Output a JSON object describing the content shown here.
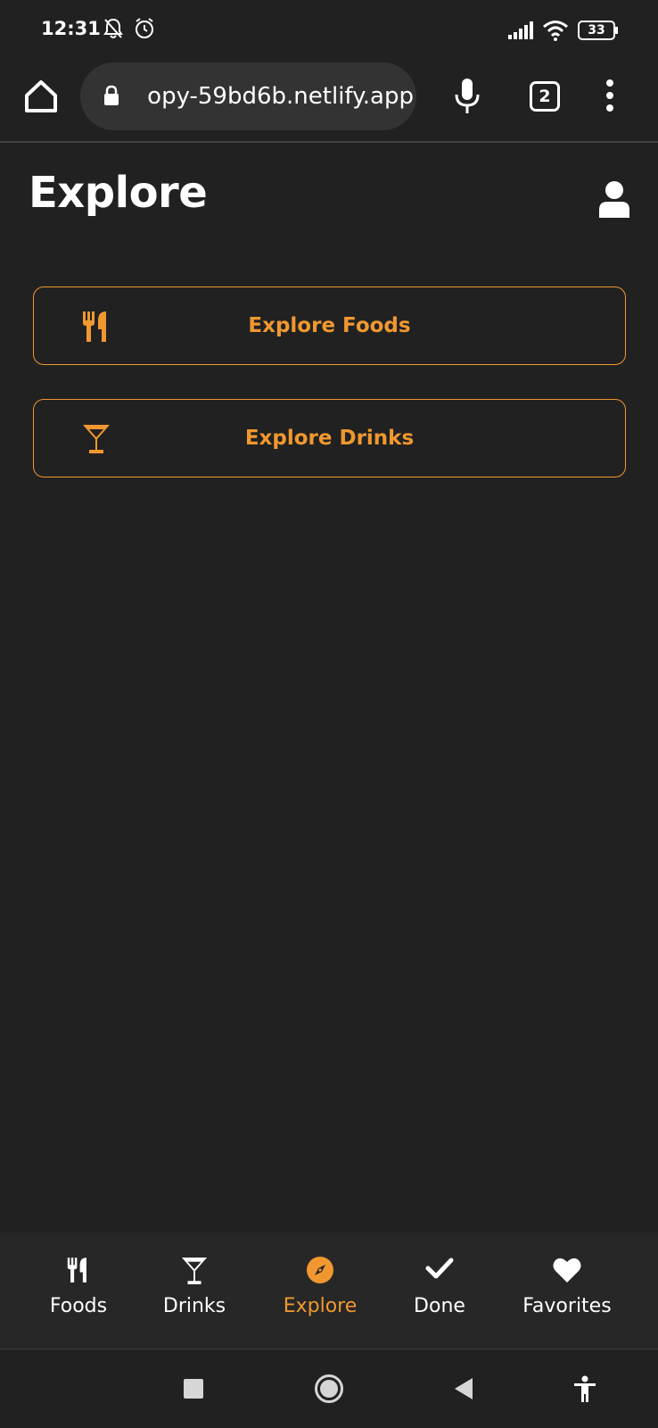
{
  "status_bar": {
    "time": "12:31",
    "icons": [
      "bell-off-icon",
      "alarm-icon",
      "signal-icon",
      "wifi-icon",
      "battery-icon"
    ],
    "battery": "33"
  },
  "browser": {
    "url": "opy-59bd6b.netlify.app",
    "tab_count": "2",
    "icons": [
      "home-icon",
      "lock-icon",
      "mic-icon",
      "tabs-icon",
      "more-vert-icon"
    ]
  },
  "page": {
    "title": "Explore",
    "profile_icon": "user-icon",
    "buttons": [
      {
        "label": "Explore Foods",
        "icon": "utensils-icon"
      },
      {
        "label": "Explore Drinks",
        "icon": "cocktail-icon"
      }
    ]
  },
  "tabbar": {
    "tabs": [
      {
        "label": "Foods",
        "icon": "utensils-icon",
        "active": false
      },
      {
        "label": "Drinks",
        "icon": "cocktail-icon",
        "active": false
      },
      {
        "label": "Explore",
        "icon": "compass-icon",
        "active": true
      },
      {
        "label": "Done",
        "icon": "check-icon",
        "active": false
      },
      {
        "label": "Favorites",
        "icon": "heart-icon",
        "active": false
      }
    ]
  },
  "navbar": {
    "icons": [
      "recents-icon",
      "home-circle-icon",
      "back-icon",
      "accessibility-icon"
    ]
  },
  "colors": {
    "background": "#212121",
    "accent": "#f0982f",
    "tabbar": "#272727",
    "url_pill": "#333333"
  }
}
